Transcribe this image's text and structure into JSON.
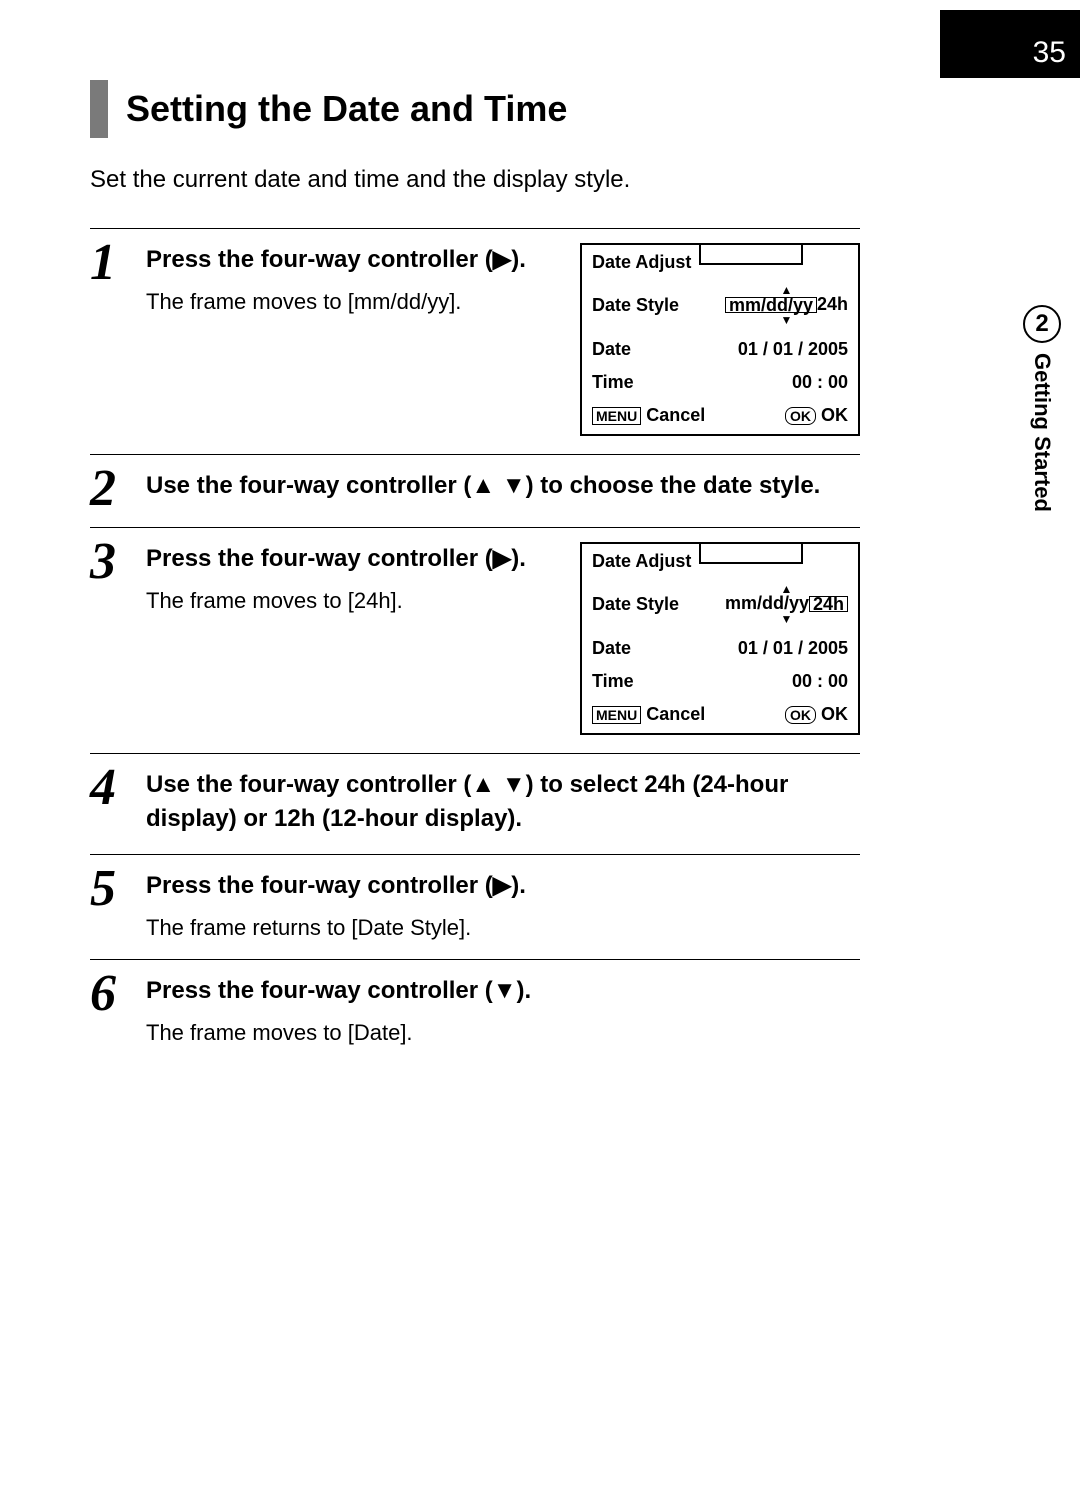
{
  "page": {
    "number": "35",
    "section_num": "2",
    "section_label": "Getting Started",
    "title": "Setting the Date and Time",
    "intro": "Set the current date and time and the display style."
  },
  "steps": [
    {
      "num": "1",
      "heading_a": "Press the four-way controller ",
      "desc": "The frame moves to [mm/dd/yy]."
    },
    {
      "num": "2",
      "heading_a": "Use the four-way controller ",
      "heading_b": " to choose the date style."
    },
    {
      "num": "3",
      "heading_a": "Press the four-way controller ",
      "desc": "The frame moves to [24h]."
    },
    {
      "num": "4",
      "heading_a": "Use the four-way controller ",
      "heading_b": " to select 24h (24-hour display) or 12h (12-hour display)."
    },
    {
      "num": "5",
      "heading_a": "Press the four-way controller ",
      "desc": "The frame returns to [Date Style]."
    },
    {
      "num": "6",
      "heading_a": "Press the four-way controller ",
      "desc": "The frame moves to [Date]."
    }
  ],
  "screens": [
    {
      "title": "Date Adjust",
      "rows": [
        {
          "label": "Date Style",
          "value_a": "mm/dd/yy",
          "value_b": "24h"
        },
        {
          "label": "Date",
          "value": "01 / 01 / 2005"
        },
        {
          "label": "Time",
          "value": "00 : 00"
        }
      ],
      "footer": {
        "menu": "MENU",
        "cancel": "Cancel",
        "ok_icon": "OK",
        "ok": "OK"
      }
    },
    {
      "title": "Date Adjust",
      "rows": [
        {
          "label": "Date Style",
          "value_a": "mm/dd/yy",
          "value_b": "24h"
        },
        {
          "label": "Date",
          "value": "01 / 01 / 2005"
        },
        {
          "label": "Time",
          "value": "00 : 00"
        }
      ],
      "footer": {
        "menu": "MENU",
        "cancel": "Cancel",
        "ok_icon": "OK",
        "ok": "OK"
      }
    }
  ]
}
